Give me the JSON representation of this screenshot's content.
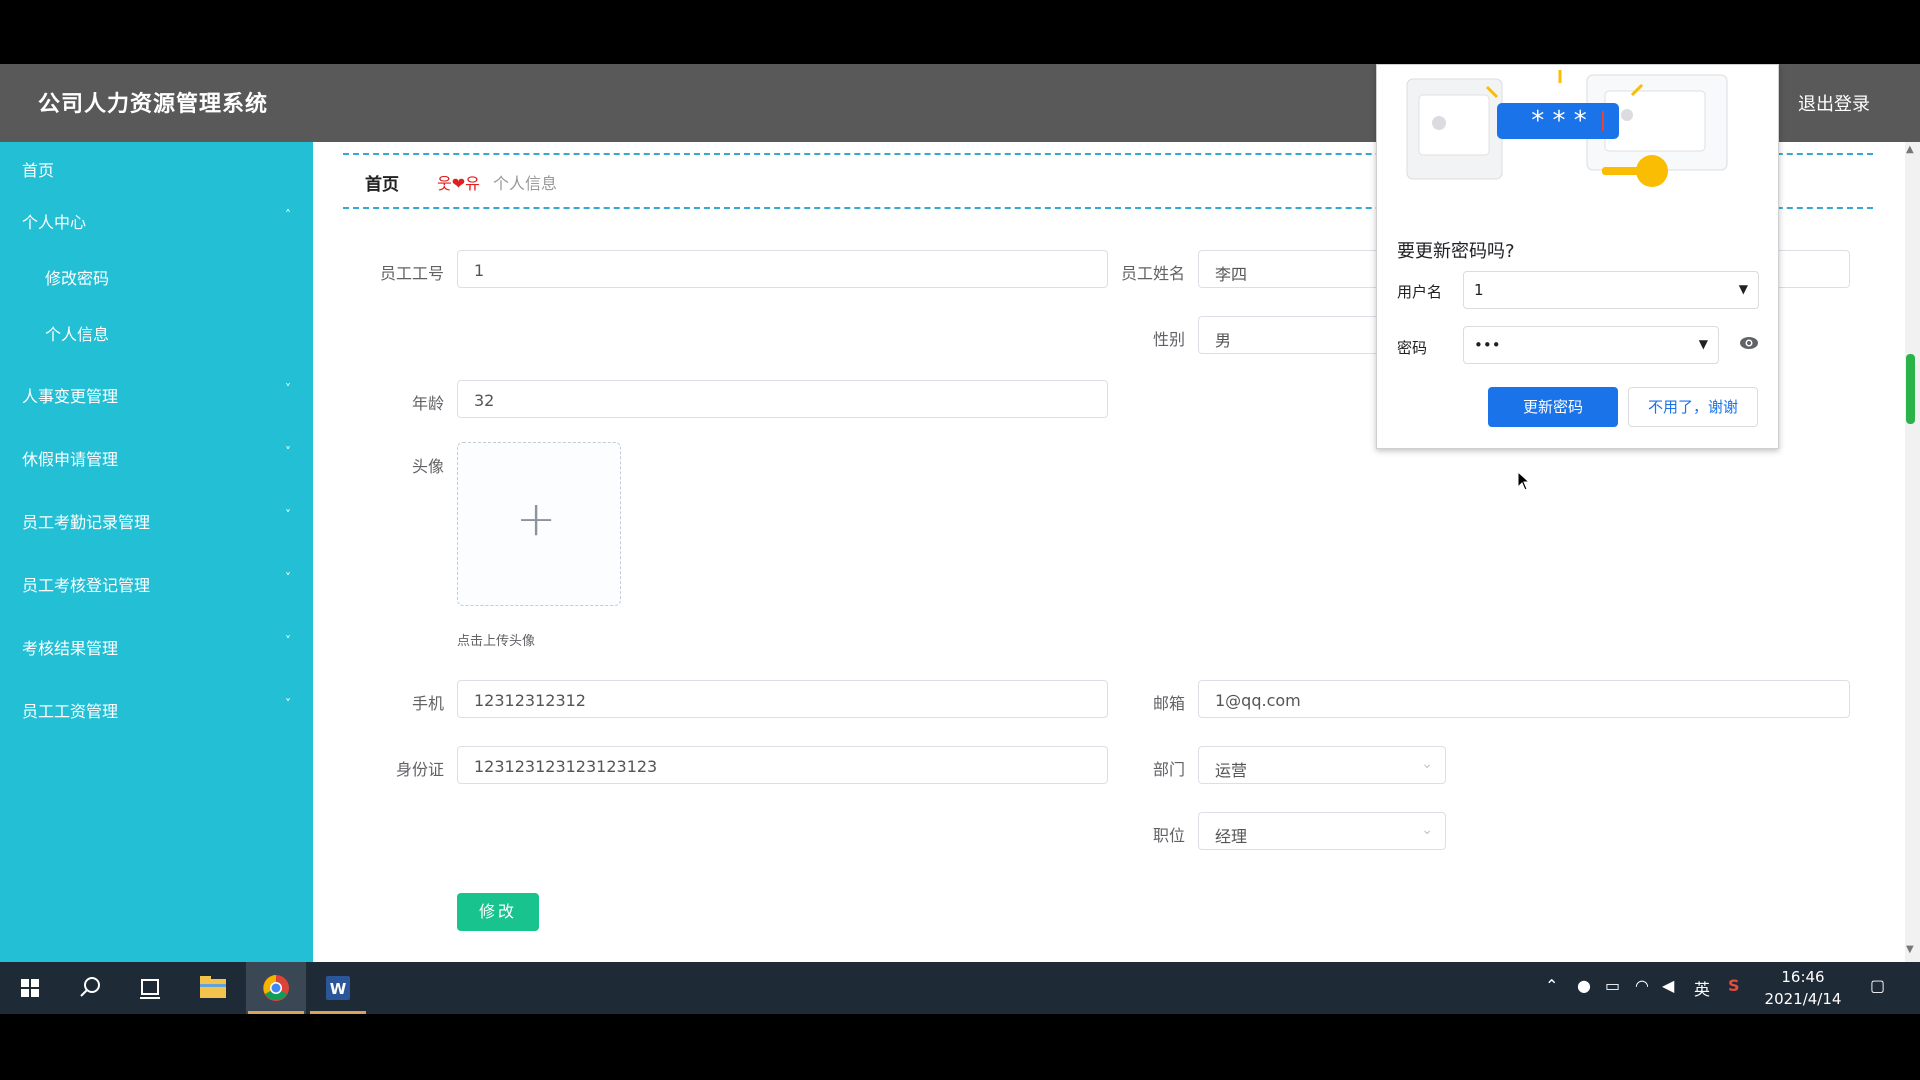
{
  "app": {
    "title": "公司人力资源管理系统",
    "logout": "退出登录"
  },
  "sidebar": {
    "items": [
      {
        "label": "首页",
        "chevron": ""
      },
      {
        "label": "个人中心",
        "chevron": "˄"
      },
      {
        "label": "修改密码",
        "chevron": ""
      },
      {
        "label": "个人信息",
        "chevron": ""
      },
      {
        "label": "人事变更管理",
        "chevron": "˅"
      },
      {
        "label": "休假申请管理",
        "chevron": "˅"
      },
      {
        "label": "员工考勤记录管理",
        "chevron": "˅"
      },
      {
        "label": "员工考核登记管理",
        "chevron": "˅"
      },
      {
        "label": "考核结果管理",
        "chevron": "˅"
      },
      {
        "label": "员工工资管理",
        "chevron": "˅"
      }
    ]
  },
  "breadcrumb": {
    "home": "首页",
    "separator": "웃❤유",
    "current": "个人信息"
  },
  "form": {
    "employee_no": {
      "label": "员工工号",
      "value": "1"
    },
    "employee_name": {
      "label": "员工姓名",
      "value": "李四"
    },
    "gender": {
      "label": "性别",
      "value": "男"
    },
    "age": {
      "label": "年龄",
      "value": "32"
    },
    "avatar": {
      "label": "头像",
      "hint": "点击上传头像"
    },
    "phone": {
      "label": "手机",
      "value": "12312312312"
    },
    "email": {
      "label": "邮箱",
      "value": "1@qq.com"
    },
    "id_card": {
      "label": "身份证",
      "value": "123123123123123123"
    },
    "department": {
      "label": "部门",
      "value": "运营"
    },
    "position": {
      "label": "职位",
      "value": "经理"
    },
    "submit": "修改"
  },
  "password_popup": {
    "title": "要更新密码吗?",
    "username_label": "用户名",
    "username_value": "1",
    "password_label": "密码",
    "password_value": "•••",
    "update_button": "更新密码",
    "dismiss_button": "不用了，谢谢"
  },
  "taskbar": {
    "time": "16:46",
    "date": "2021/4/14",
    "ime": "英"
  },
  "colors": {
    "sidebar": "#22bfd5",
    "topbar": "#595959",
    "submit": "#18c38d",
    "popup_primary": "#1a73e8"
  }
}
